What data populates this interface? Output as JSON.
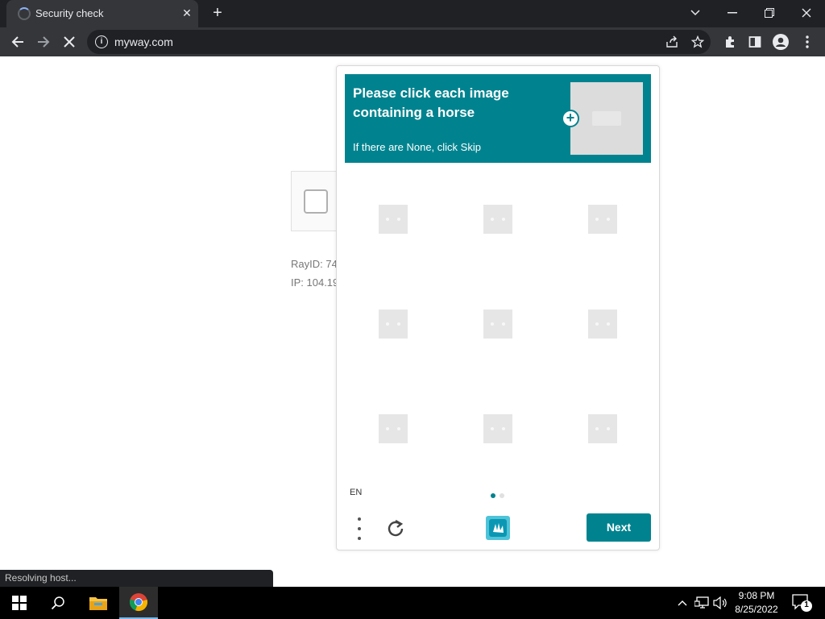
{
  "browser": {
    "tab_title": "Security check",
    "tab_close": "✕",
    "new_tab": "+",
    "address": "myway.com",
    "info_glyph": "i"
  },
  "page": {
    "ray_id": "RayID: 74",
    "ip": "IP: 104.19"
  },
  "captcha": {
    "prompt": "Please click each image containing a horse",
    "subtext": "If there are None, click Skip",
    "language": "EN",
    "next_label": "Next",
    "plus_glyph": "+",
    "tile_count": 9,
    "accent_color": "#00838f"
  },
  "status_bar": {
    "text": "Resolving host..."
  },
  "taskbar": {
    "time": "9:08 PM",
    "date": "8/25/2022",
    "notification_count": "1"
  },
  "icons": [
    "spinner-icon",
    "close-icon",
    "plus-icon",
    "chevron-down-icon",
    "minimize-icon",
    "restore-icon",
    "back-arrow-icon",
    "forward-arrow-icon",
    "stop-icon",
    "info-icon",
    "share-icon",
    "star-icon",
    "extensions-icon",
    "side-panel-icon",
    "profile-icon",
    "menu-icon",
    "checkbox-icon",
    "refresh-icon",
    "hcaptcha-logo-icon",
    "windows-start-icon",
    "search-icon",
    "file-explorer-icon",
    "chrome-icon",
    "chevron-up-icon",
    "network-icon",
    "volume-icon",
    "notification-icon"
  ]
}
